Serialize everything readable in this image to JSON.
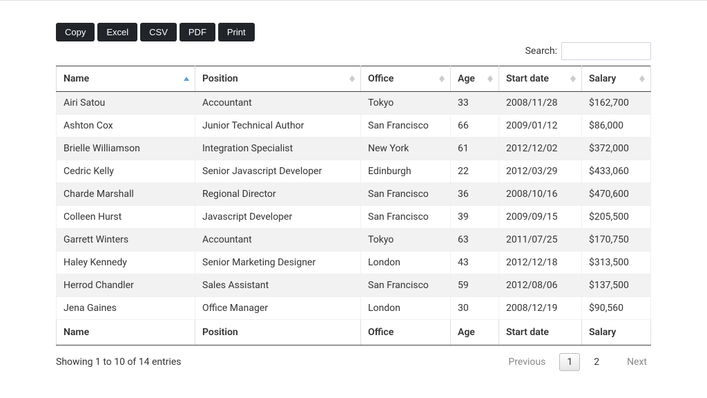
{
  "toolbar": {
    "buttons": {
      "copy": "Copy",
      "excel": "Excel",
      "csv": "CSV",
      "pdf": "PDF",
      "print": "Print"
    }
  },
  "search": {
    "label": "Search:",
    "value": ""
  },
  "columns": {
    "name": "Name",
    "position": "Position",
    "office": "Office",
    "age": "Age",
    "start_date": "Start date",
    "salary": "Salary"
  },
  "sort": {
    "column": "name",
    "direction": "asc"
  },
  "rows": [
    {
      "name": "Airi Satou",
      "position": "Accountant",
      "office": "Tokyo",
      "age": "33",
      "start_date": "2008/11/28",
      "salary": "$162,700"
    },
    {
      "name": "Ashton Cox",
      "position": "Junior Technical Author",
      "office": "San Francisco",
      "age": "66",
      "start_date": "2009/01/12",
      "salary": "$86,000"
    },
    {
      "name": "Brielle Williamson",
      "position": "Integration Specialist",
      "office": "New York",
      "age": "61",
      "start_date": "2012/12/02",
      "salary": "$372,000"
    },
    {
      "name": "Cedric Kelly",
      "position": "Senior Javascript Developer",
      "office": "Edinburgh",
      "age": "22",
      "start_date": "2012/03/29",
      "salary": "$433,060"
    },
    {
      "name": "Charde Marshall",
      "position": "Regional Director",
      "office": "San Francisco",
      "age": "36",
      "start_date": "2008/10/16",
      "salary": "$470,600"
    },
    {
      "name": "Colleen Hurst",
      "position": "Javascript Developer",
      "office": "San Francisco",
      "age": "39",
      "start_date": "2009/09/15",
      "salary": "$205,500"
    },
    {
      "name": "Garrett Winters",
      "position": "Accountant",
      "office": "Tokyo",
      "age": "63",
      "start_date": "2011/07/25",
      "salary": "$170,750"
    },
    {
      "name": "Haley Kennedy",
      "position": "Senior Marketing Designer",
      "office": "London",
      "age": "43",
      "start_date": "2012/12/18",
      "salary": "$313,500"
    },
    {
      "name": "Herrod Chandler",
      "position": "Sales Assistant",
      "office": "San Francisco",
      "age": "59",
      "start_date": "2012/08/06",
      "salary": "$137,500"
    },
    {
      "name": "Jena Gaines",
      "position": "Office Manager",
      "office": "London",
      "age": "30",
      "start_date": "2008/12/19",
      "salary": "$90,560"
    }
  ],
  "info": "Showing 1 to 10 of 14 entries",
  "pagination": {
    "previous": "Previous",
    "next": "Next",
    "pages": [
      "1",
      "2"
    ],
    "current": "1"
  }
}
